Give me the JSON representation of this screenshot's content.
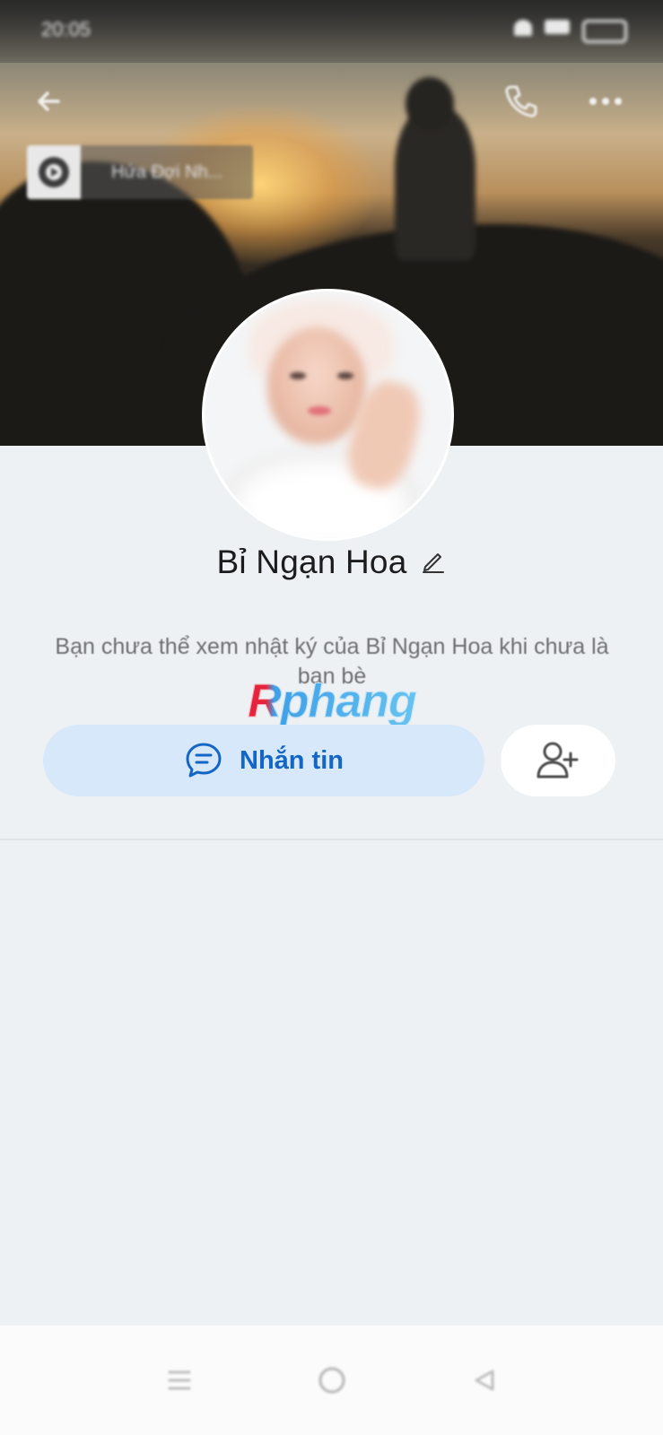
{
  "status_bar": {
    "time": "20:05"
  },
  "music": {
    "title": "Hứa Đợi Nh..."
  },
  "profile": {
    "name": "Bỉ Ngạn Hoa",
    "info_text": "Bạn chưa thể xem nhật ký của Bỉ Ngạn Hoa khi chưa là bạn bè"
  },
  "actions": {
    "message_label": "Nhắn tin"
  },
  "watermark": "Rphang",
  "icons": {
    "back": "back-arrow-icon",
    "call": "phone-icon",
    "more": "more-dots-icon",
    "edit": "pencil-icon",
    "message": "chat-bubble-icon",
    "add_friend": "add-friend-icon"
  },
  "colors": {
    "accent": "#1466c5",
    "message_button_bg": "#d7e8fa",
    "page_bg": "#eef1f4"
  }
}
